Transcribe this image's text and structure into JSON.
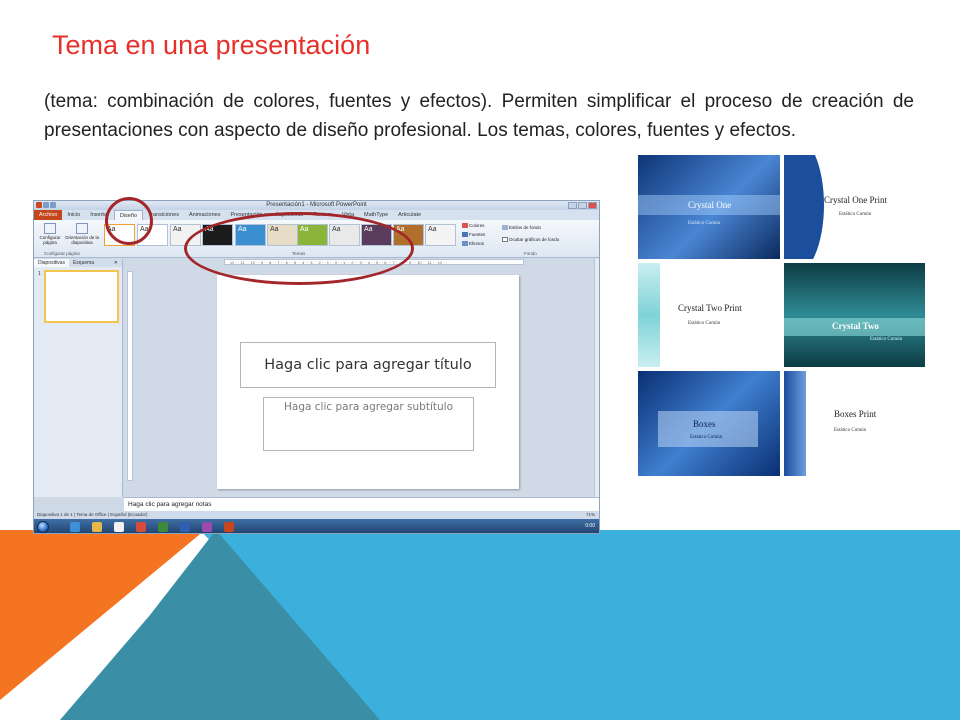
{
  "slide": {
    "title": "Tema en una presentación",
    "body": "(tema: combinación de colores, fuentes y efectos). Permiten simplificar el proceso de creación de presentaciones con aspecto de diseño profesional. Los temas, colores, fuentes y efectos.",
    "colors": {
      "title": "#e8302a",
      "orange": "#f47421",
      "blue": "#3cb0dc",
      "teal": "#3a8fa6",
      "annotation": "#a3262a"
    }
  },
  "ppt": {
    "window_title": "Presentación1 - Microsoft PowerPoint",
    "tabs": [
      "Archivo",
      "Inicio",
      "Insertar",
      "Diseño",
      "Transiciones",
      "Animaciones",
      "Presentación con diapositivas",
      "Revisar",
      "Vista",
      "MathType",
      "Articulate"
    ],
    "active_tab": "Diseño",
    "ribbon": {
      "page_setup": "Configurar página",
      "orientation": "Orientación de la diapositiva",
      "group_page": "Configurar página",
      "group_themes": "Temas",
      "group_background": "Fondo",
      "colors": "Colores",
      "fonts": "Fuentes",
      "effects": "Efectos",
      "bg_styles": "Estilos de fondo",
      "hide_bg": "Ocultar gráficos de fondo",
      "theme_label": "Aa"
    },
    "panel": {
      "tab_slides": "Diapositivas",
      "tab_outline": "Esquema",
      "close": "✕",
      "slide_number": "1"
    },
    "ruler": "· · 12 · · 11 · · 10 · · 9 · · 8 · · 7 · · 6 · · 5 · · 4 · · 3 · · 2 · · 1 · · 0 · · 1 · · 2 · · 3 · · 4 · · 5 · · 6 · · 7 · · 8 · · 9 · · 10 · · 11 · · 12 · ·",
    "title_placeholder": "Haga clic para agregar título",
    "subtitle_placeholder": "Haga clic para agregar subtítulo",
    "notes_placeholder": "Haga clic para agregar notas",
    "status_slide": "Diapositiva 1 de 1",
    "status_theme": "Tema de Office",
    "status_lang": "Español (Ecuador)",
    "zoom": "71%",
    "clock": "0:00"
  },
  "gallery": [
    {
      "title": "Crystal One",
      "subtitle": "Estático Común",
      "bg": "#2a5fa8"
    },
    {
      "title": "Crystal One Print",
      "subtitle": "Estático Común",
      "bg": "#ffffff"
    },
    {
      "title": "Crystal Two Print",
      "subtitle": "Estático Común",
      "bg": "#ffffff"
    },
    {
      "title": "Crystal Two",
      "subtitle": "Estático Común",
      "bg": "#1e5f6a"
    },
    {
      "title": "Boxes",
      "subtitle": "Estático Común",
      "bg": "#1c4f9c"
    },
    {
      "title": "Boxes Print",
      "subtitle": "Estático Común",
      "bg": "#ffffff"
    }
  ]
}
